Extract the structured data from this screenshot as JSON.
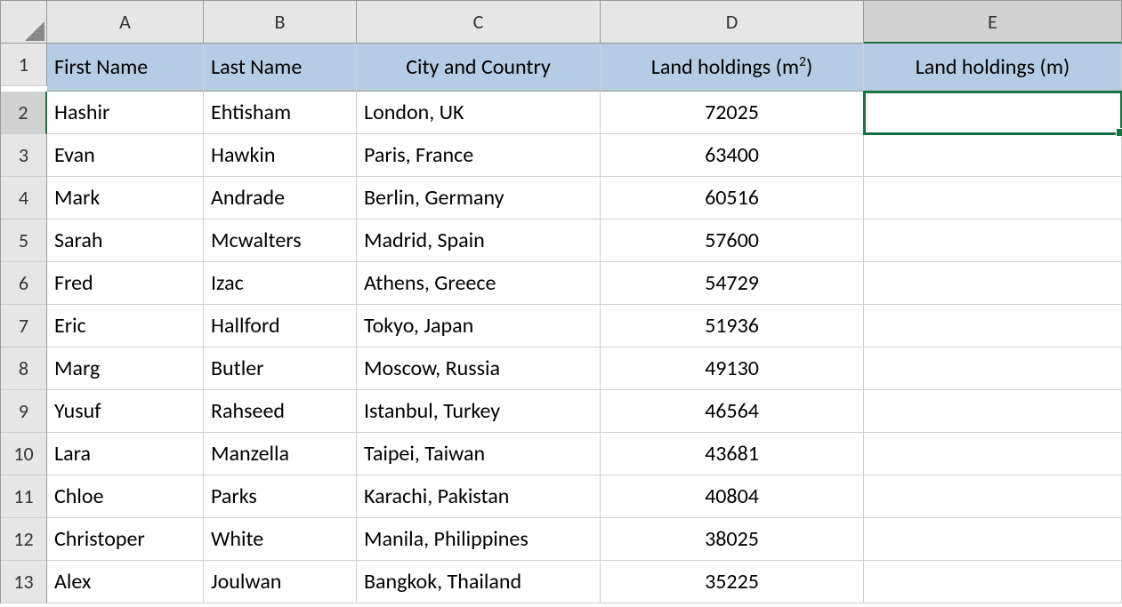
{
  "columns": [
    "A",
    "B",
    "C",
    "D",
    "E"
  ],
  "row_numbers": [
    "1",
    "2",
    "3",
    "4",
    "5",
    "6",
    "7",
    "8",
    "9",
    "10",
    "11",
    "12",
    "13"
  ],
  "active_col_index": 4,
  "active_row_index": 1,
  "headers": {
    "first_name": "First Name",
    "last_name": "Last Name",
    "city_country": "City and Country",
    "land_m2_prefix": "Land holdings (m",
    "land_m2_sup": "2",
    "land_m2_suffix": ")",
    "land_m": "Land holdings (m)"
  },
  "rows": [
    {
      "first": "Hashir",
      "last": "Ehtisham",
      "city": "London, UK",
      "m2": "72025",
      "m": ""
    },
    {
      "first": "Evan",
      "last": "Hawkin",
      "city": "Paris, France",
      "m2": "63400",
      "m": ""
    },
    {
      "first": "Mark",
      "last": "Andrade",
      "city": "Berlin, Germany",
      "m2": "60516",
      "m": ""
    },
    {
      "first": "Sarah",
      "last": "Mcwalters",
      "city": "Madrid, Spain",
      "m2": "57600",
      "m": ""
    },
    {
      "first": "Fred",
      "last": "Izac",
      "city": "Athens, Greece",
      "m2": "54729",
      "m": ""
    },
    {
      "first": "Eric",
      "last": "Hallford",
      "city": "Tokyo, Japan",
      "m2": "51936",
      "m": ""
    },
    {
      "first": "Marg",
      "last": "Butler",
      "city": "Moscow, Russia",
      "m2": "49130",
      "m": ""
    },
    {
      "first": "Yusuf",
      "last": "Rahseed",
      "city": "Istanbul, Turkey",
      "m2": "46564",
      "m": ""
    },
    {
      "first": "Lara",
      "last": "Manzella",
      "city": "Taipei, Taiwan",
      "m2": "43681",
      "m": ""
    },
    {
      "first": "Chloe",
      "last": "Parks",
      "city": "Karachi, Pakistan",
      "m2": "40804",
      "m": ""
    },
    {
      "first": "Christoper",
      "last": "White",
      "city": "Manila, Philippines",
      "m2": "38025",
      "m": ""
    },
    {
      "first": "Alex",
      "last": "Joulwan",
      "city": "Bangkok, Thailand",
      "m2": "35225",
      "m": ""
    }
  ]
}
